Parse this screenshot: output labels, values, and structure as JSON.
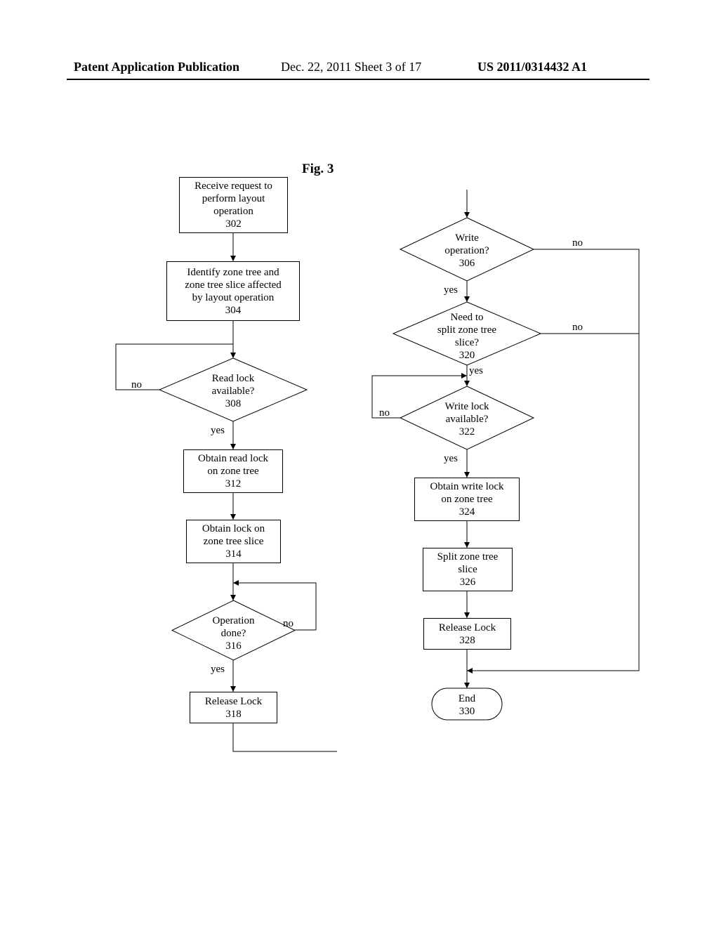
{
  "header": {
    "left": "Patent Application Publication",
    "center": "Dec. 22, 2011  Sheet 3 of 17",
    "right": "US 2011/0314432 A1"
  },
  "figure_title": "Fig. 3",
  "boxes": {
    "b302": {
      "l1": "Receive request to",
      "l2": "perform layout",
      "l3": "operation",
      "num": "302"
    },
    "b304": {
      "l1": "Identify zone tree and",
      "l2": "zone tree slice affected",
      "l3": "by layout operation",
      "num": "304"
    },
    "b312": {
      "l1": "Obtain read lock",
      "l2": "on zone tree",
      "num": "312"
    },
    "b314": {
      "l1": "Obtain lock on",
      "l2": "zone tree slice",
      "num": "314"
    },
    "b318": {
      "l1": "Release Lock",
      "num": "318"
    },
    "b324": {
      "l1": "Obtain write lock",
      "l2": "on zone tree",
      "num": "324"
    },
    "b326": {
      "l1": "Split zone tree",
      "l2": "slice",
      "num": "326"
    },
    "b328": {
      "l1": "Release Lock",
      "num": "328"
    }
  },
  "diamonds": {
    "d308": {
      "l1": "Read lock",
      "l2": "available?",
      "num": "308"
    },
    "d316": {
      "l1": "Operation",
      "l2": "done?",
      "num": "316"
    },
    "d306": {
      "l1": "Write",
      "l2": "operation?",
      "num": "306"
    },
    "d320": {
      "l1": "Need to",
      "l2": "split zone tree",
      "l3": "slice?",
      "num": "320"
    },
    "d322": {
      "l1": "Write lock",
      "l2": "available?",
      "num": "322"
    }
  },
  "terminator": {
    "l1": "End",
    "num": "330"
  },
  "labels": {
    "yes": "yes",
    "no": "no"
  }
}
